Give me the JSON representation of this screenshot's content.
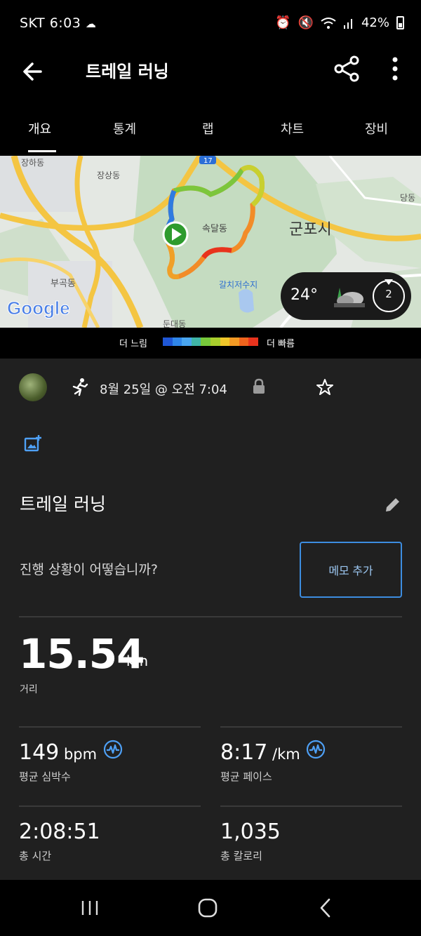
{
  "status": {
    "carrier_time": "SKT 6:03",
    "battery": "42%"
  },
  "header": {
    "title": "트레일 러닝"
  },
  "tabs": [
    {
      "label": "개요",
      "active": true
    },
    {
      "label": "통계"
    },
    {
      "label": "랩"
    },
    {
      "label": "차트"
    },
    {
      "label": "장비"
    }
  ],
  "map": {
    "labels": {
      "jangha": "장하동",
      "jangsang": "장상동",
      "sokdal": "속달동",
      "gunpo": "군포시",
      "bugok": "부곡동",
      "galchi": "갈치저수지",
      "dang": "당동",
      "daeya": "둔대동",
      "road": "17",
      "google": "Google"
    },
    "weather": {
      "temp": "24°",
      "wind": "2"
    }
  },
  "legend": {
    "slow": "더 느림",
    "fast": "더 빠름",
    "colors": [
      "#1f57d6",
      "#2f86ea",
      "#49a6f0",
      "#3fb5a7",
      "#77c93b",
      "#a9cf2d",
      "#f0c72a",
      "#f39a24",
      "#f0641d",
      "#e8331d"
    ]
  },
  "activity": {
    "date": "8월 25일 @ 오전 7:04",
    "name": "트레일 러닝",
    "prompt": "진행 상황이 어떻습니까?",
    "memo_button": "메모 추가"
  },
  "stats": {
    "distance": {
      "value": "15.54",
      "unit": "km",
      "label": "거리"
    },
    "heart_rate": {
      "value": "149",
      "unit": " bpm",
      "label": "평균 심박수"
    },
    "pace": {
      "value": "8:17",
      "unit": " /km",
      "label": "평균 페이스"
    },
    "time": {
      "value": "2:08:51",
      "label": "총 시간"
    },
    "calories": {
      "value": "1,035",
      "label": "총 칼로리"
    }
  },
  "colors": {
    "accent": "#3d8de0",
    "background": "#202020",
    "start_marker": "#2e9b2e"
  }
}
